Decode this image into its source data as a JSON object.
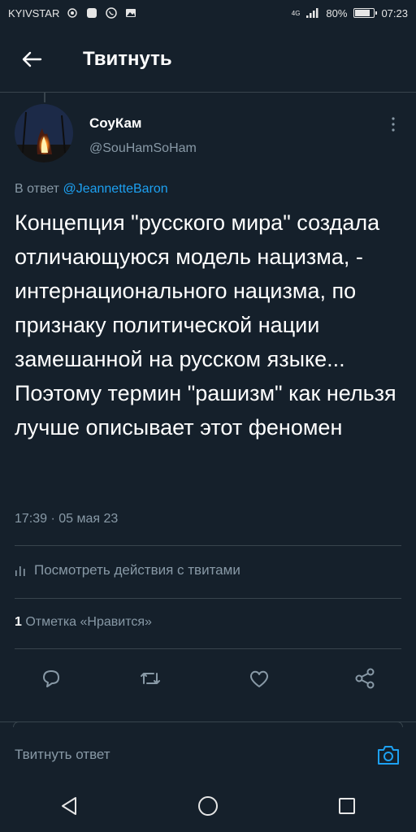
{
  "status_bar": {
    "carrier": "KYIVSTAR",
    "network": "4G",
    "battery_text": "80%",
    "battery_level": 0.8,
    "time": "07:23"
  },
  "header": {
    "title": "Твитнуть",
    "back_icon": "arrow-left-icon"
  },
  "tweet": {
    "author_name": "СоуКам",
    "author_handle": "@SouHamSoHam",
    "reply_prefix": "В ответ",
    "reply_to": "@JeannetteBaron",
    "text": "Концепция \"русского мира\" создала отличающуюся модель нацизма, - интернационального нацизма, по признаку политической нации замешанной на русском языке... Поэтому термин \"рашизм\" как нельзя лучше описывает этот феномен",
    "time": "17:39 · 05 мая 23",
    "activity_label": "Посмотреть действия с твитами",
    "likes_count": "1",
    "likes_label": "Отметка «Нравится»"
  },
  "actions": [
    "reply-icon",
    "retweet-icon",
    "like-icon",
    "share-icon"
  ],
  "reply_input": {
    "placeholder": "Твитнуть ответ"
  },
  "colors": {
    "background": "#15202b",
    "divider": "#38444d",
    "secondary_text": "#8899a6",
    "accent": "#1da1f2"
  }
}
